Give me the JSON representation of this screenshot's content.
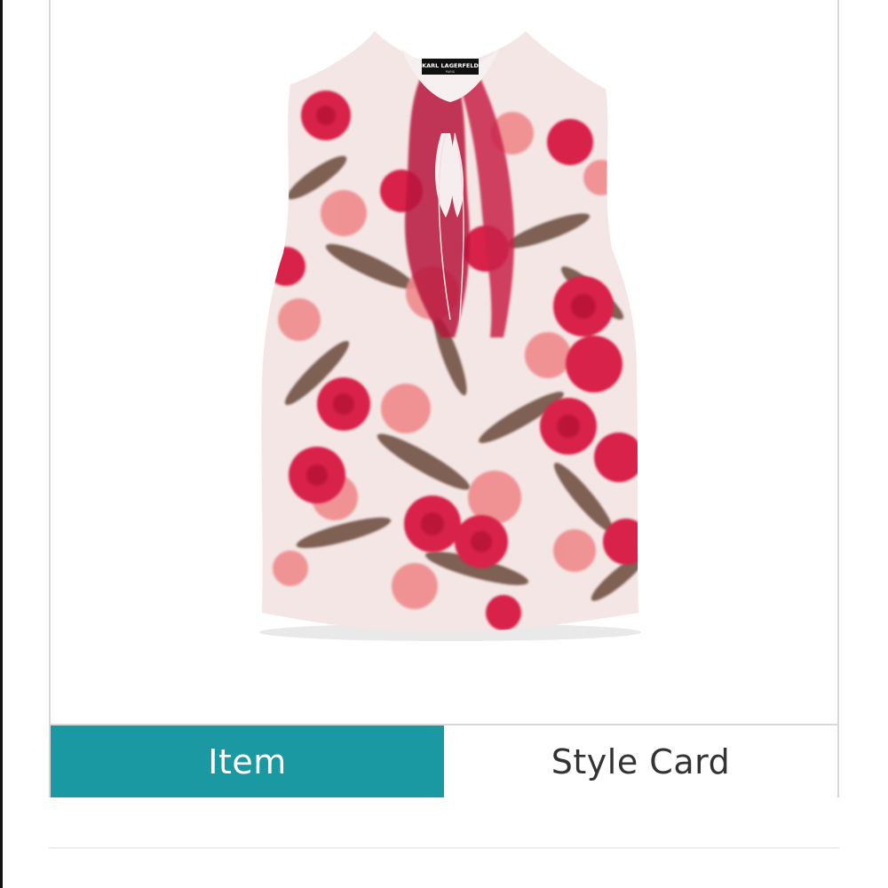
{
  "product": {
    "brand_label": "KARL LAGERFELD",
    "brand_sublabel": "PARIS"
  },
  "tabs": [
    {
      "label": "Item",
      "active": true
    },
    {
      "label": "Style Card",
      "active": false
    }
  ],
  "colors": {
    "active_tab": "#1a99a3",
    "active_tab_text": "#ffffff",
    "inactive_tab_text": "#333333",
    "border": "#d8d8d8"
  }
}
